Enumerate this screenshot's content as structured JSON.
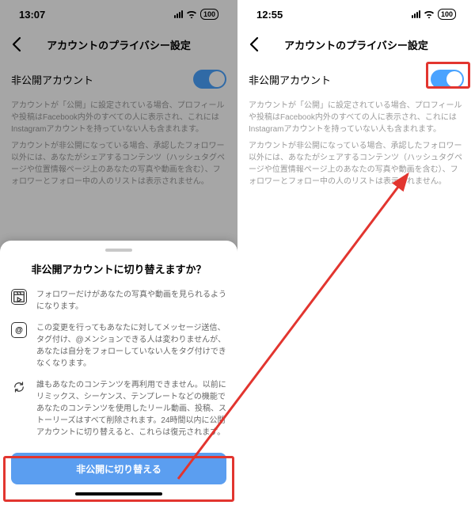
{
  "left": {
    "status_time": "13:07",
    "battery": "100",
    "page_title": "アカウントのプライバシー設定",
    "private_account_label": "非公開アカウント",
    "desc1": "アカウントが「公開」に設定されている場合、プロフィールや投稿はFacebook内外のすべての人に表示され、これにはInstagramアカウントを持っていない人も含まれます。",
    "desc2": "アカウントが非公開になっている場合、承認したフォロワー以外には、あなたがシェアするコンテンツ（ハッシュタグページや位置情報ページ上のあなたの写真や動画を含む）、フォロワーとフォロー中の人のリストは表示されません。",
    "sheet_title": "非公開アカウントに切り替えますか？",
    "item1": "フォロワーだけがあなたの写真や動画を見られるようになります。",
    "item2": "この変更を行ってもあなたに対してメッセージ送信、タグ付け、@メンションできる人は変わりませんが、あなたは自分をフォローしていない人をタグ付けできなくなります。",
    "item3": "誰もあなたのコンテンツを再利用できません。以前にリミックス、シーケンス、テンプレートなどの機能であなたのコンテンツを使用したリール動画、投稿、ストーリーズはすべて削除されます。24時間以内に公開アカウントに切り替えると、これらは復元されます。",
    "button_label": "非公開に切り替える"
  },
  "right": {
    "status_time": "12:55",
    "battery": "100",
    "page_title": "アカウントのプライバシー設定",
    "private_account_label": "非公開アカウント",
    "desc1": "アカウントが「公開」に設定されている場合、プロフィールや投稿はFacebook内外のすべての人に表示され、これにはInstagramアカウントを持っていない人も含まれます。",
    "desc2": "アカウントが非公開になっている場合、承認したフォロワー以外には、あなたがシェアするコンテンツ（ハッシュタグページや位置情報ページ上のあなたの写真や動画を含む）、フォロワーとフォロー中の人のリストは表示されません。"
  }
}
